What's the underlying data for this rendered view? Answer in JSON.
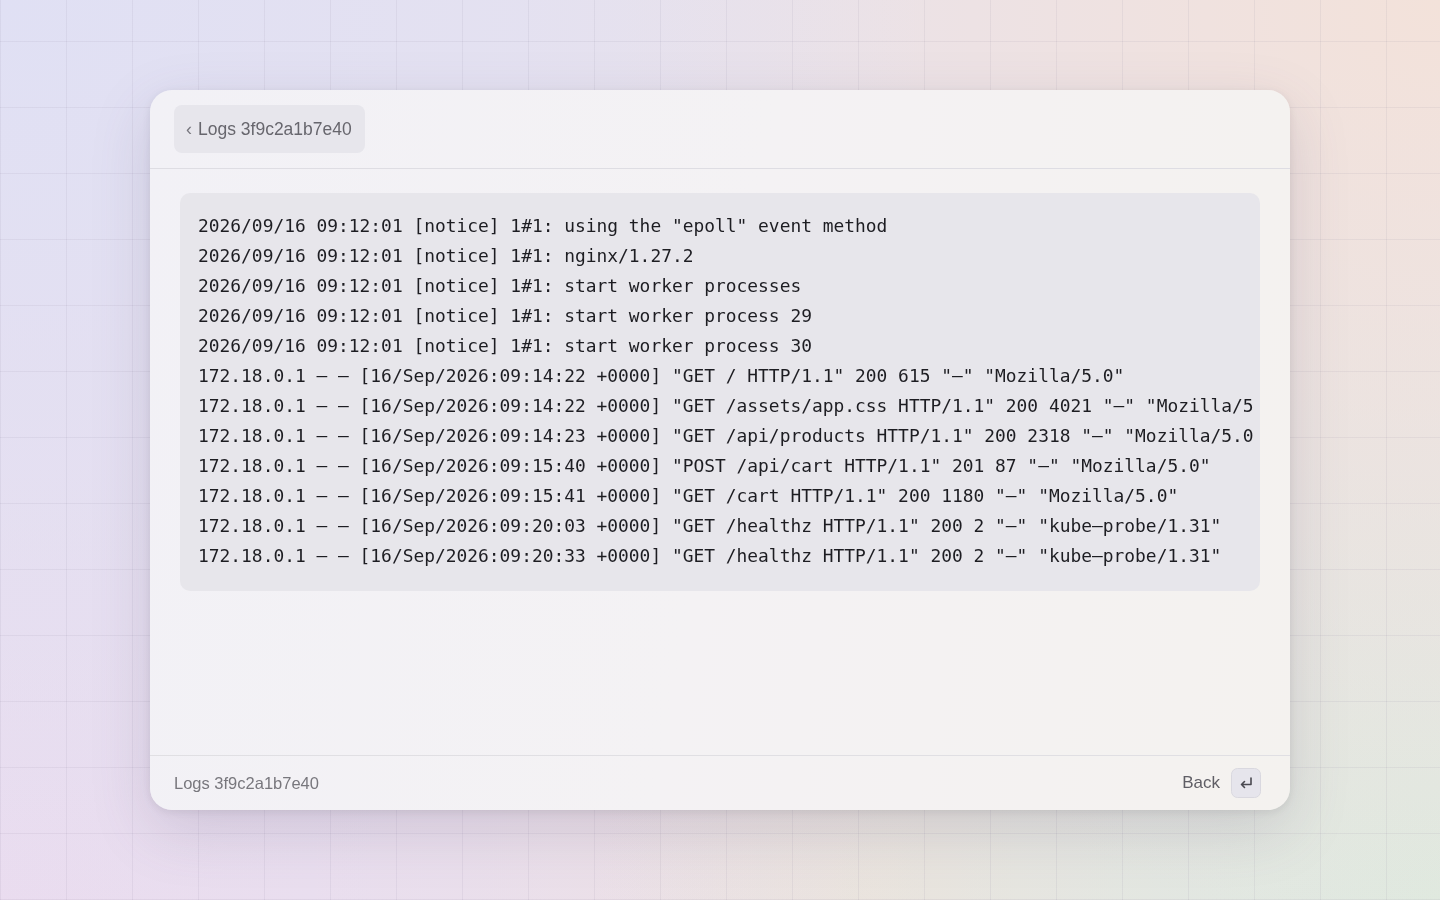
{
  "header": {
    "back_button": {
      "icon": "‹",
      "label": "Logs 3f9c2a1b7e40"
    }
  },
  "log": {
    "lines": [
      "2026/09/16 09:12:01 [notice] 1#1: using the \"epoll\" event method",
      "2026/09/16 09:12:01 [notice] 1#1: nginx/1.27.2",
      "2026/09/16 09:12:01 [notice] 1#1: start worker processes",
      "2026/09/16 09:12:01 [notice] 1#1: start worker process 29",
      "2026/09/16 09:12:01 [notice] 1#1: start worker process 30",
      "172.18.0.1 – – [16/Sep/2026:09:14:22 +0000] \"GET / HTTP/1.1\" 200 615 \"–\" \"Mozilla/5.0\"",
      "172.18.0.1 – – [16/Sep/2026:09:14:22 +0000] \"GET /assets/app.css HTTP/1.1\" 200 4021 \"–\" \"Mozilla/5",
      "172.18.0.1 – – [16/Sep/2026:09:14:23 +0000] \"GET /api/products HTTP/1.1\" 200 2318 \"–\" \"Mozilla/5.0",
      "172.18.0.1 – – [16/Sep/2026:09:15:40 +0000] \"POST /api/cart HTTP/1.1\" 201 87 \"–\" \"Mozilla/5.0\"",
      "172.18.0.1 – – [16/Sep/2026:09:15:41 +0000] \"GET /cart HTTP/1.1\" 200 1180 \"–\" \"Mozilla/5.0\"",
      "172.18.0.1 – – [16/Sep/2026:09:20:03 +0000] \"GET /healthz HTTP/1.1\" 200 2 \"–\" \"kube–probe/1.31\"",
      "172.18.0.1 – – [16/Sep/2026:09:20:33 +0000] \"GET /healthz HTTP/1.1\" 200 2 \"–\" \"kube–probe/1.31\""
    ]
  },
  "footer": {
    "title": "Logs 3f9c2a1b7e40",
    "action": {
      "label": "Back"
    }
  }
}
